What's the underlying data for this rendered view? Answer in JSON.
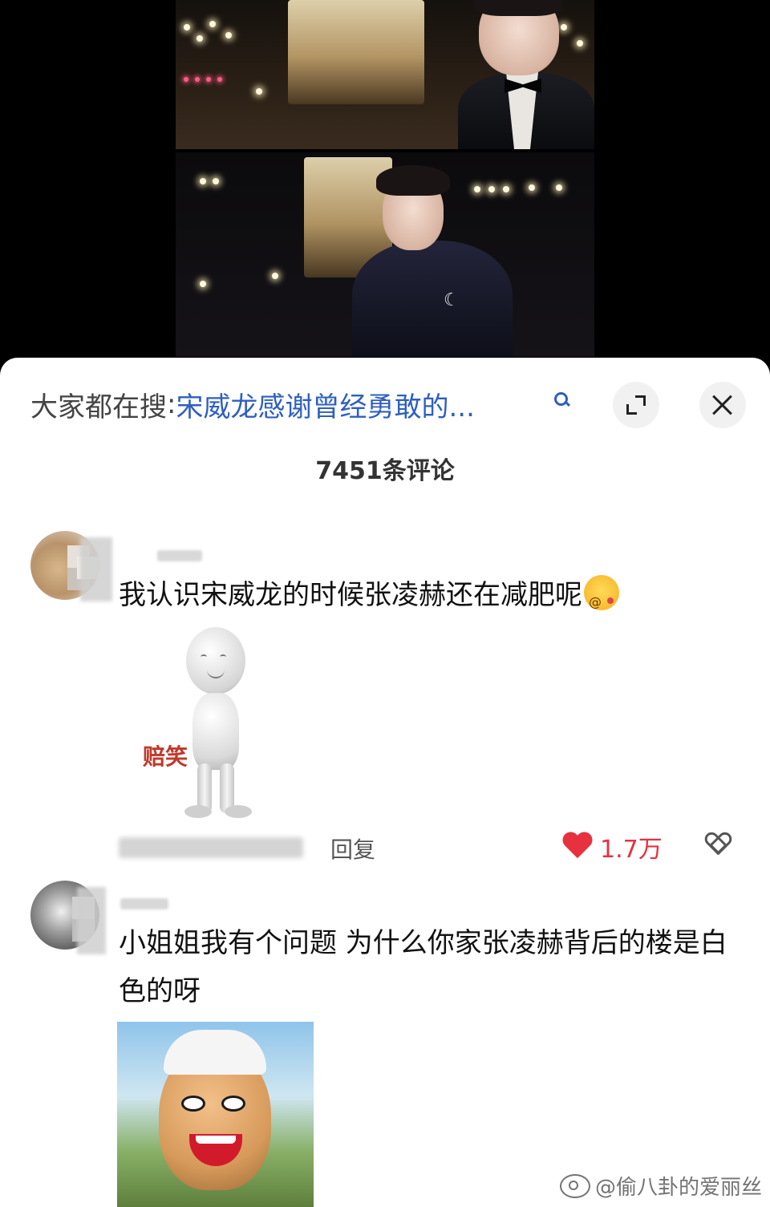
{
  "search": {
    "prefix": "大家都在搜",
    "separator": ":",
    "query": "宋威龙感谢曾经勇敢的..."
  },
  "header": {
    "comment_count": "7451条评论"
  },
  "comments": [
    {
      "text": "我认识宋威龙的时候张凌赫还在减肥呢",
      "sticker_caption": "赔笑",
      "reply_label": "回复",
      "likes": "1.7万"
    },
    {
      "text": "小姐姐我有个问题 为什么你家张凌赫背后的楼是白色的呀"
    }
  ],
  "watermark": {
    "text": "@偷八卦的爱丽丝"
  },
  "colors": {
    "query_blue": "#2f5fbf",
    "like_red": "#e8313f",
    "caption_red": "#c0392b"
  },
  "icons": [
    "search-icon",
    "expand-icon",
    "close-icon",
    "heart-icon",
    "dislike-icon",
    "weibo-icon"
  ]
}
